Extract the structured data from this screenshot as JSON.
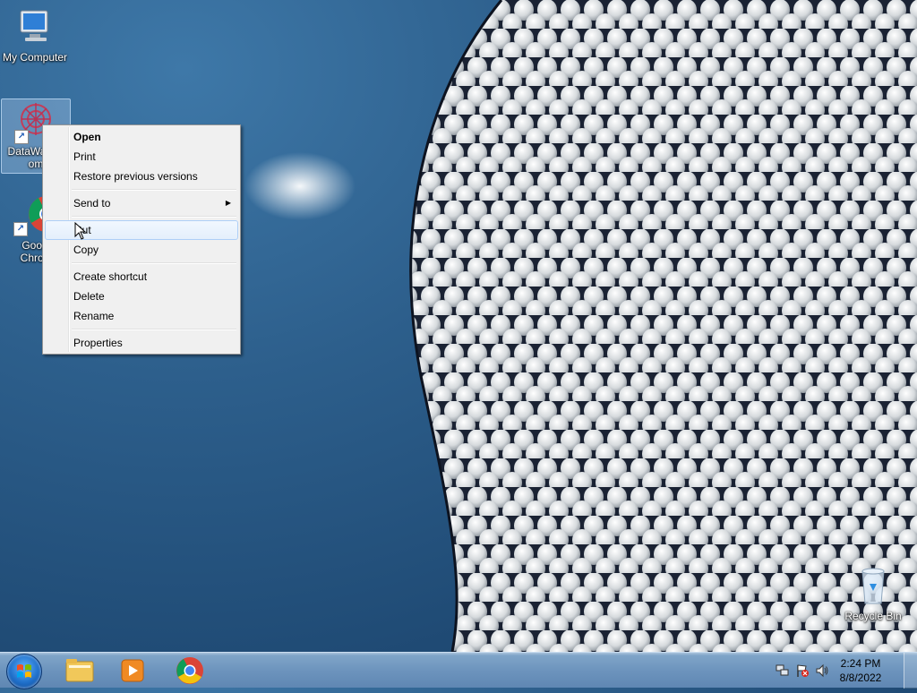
{
  "desktop": {
    "icons": [
      {
        "label": "My Computer"
      },
      {
        "label": "DataWagon\nom"
      },
      {
        "label": "Goog\nChron"
      },
      {
        "label": "Recycle Bin"
      }
    ]
  },
  "context_menu": {
    "items": [
      {
        "label": "Open"
      },
      {
        "label": "Print"
      },
      {
        "label": "Restore previous versions"
      },
      {
        "label": "Send to"
      },
      {
        "label": "Cut"
      },
      {
        "label": "Copy"
      },
      {
        "label": "Create shortcut"
      },
      {
        "label": "Delete"
      },
      {
        "label": "Rename"
      },
      {
        "label": "Properties"
      }
    ]
  },
  "taskbar": {
    "clock_time": "2:24 PM",
    "clock_date": "8/8/2022",
    "pinned": [
      "explorer-icon",
      "media-player-icon",
      "chrome-icon"
    ]
  }
}
